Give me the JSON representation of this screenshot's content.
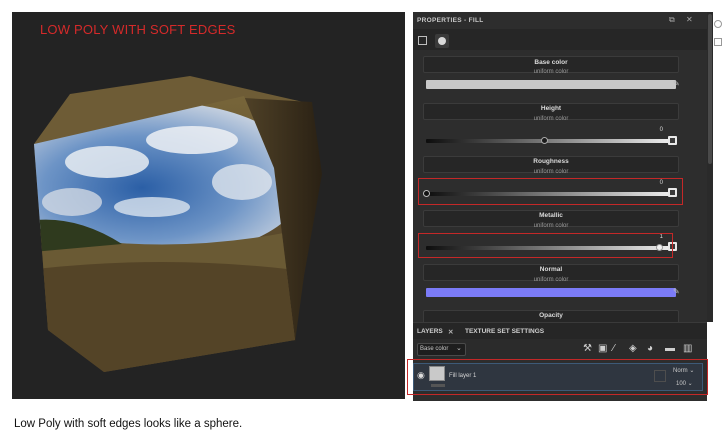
{
  "viewport": {
    "title": "LOW POLY WITH SOFT EDGES"
  },
  "properties_panel": {
    "title": "PROPERTIES - FILL",
    "window_buttons": [
      "⧉",
      "✕"
    ],
    "channels": [
      {
        "name": "Base color",
        "mode": "uniform color",
        "type": "color",
        "color": "#c8c8c8"
      },
      {
        "name": "Height",
        "mode": "uniform color",
        "type": "slider",
        "value": "0",
        "level": 0.5
      },
      {
        "name": "Roughness",
        "mode": "uniform color",
        "type": "slider",
        "value": "0",
        "level": 0.0
      },
      {
        "name": "Metallic",
        "mode": "uniform color",
        "type": "slider",
        "value": "1",
        "level": 1.0
      },
      {
        "name": "Normal",
        "mode": "uniform color",
        "type": "color",
        "color": "#7b7bf7"
      },
      {
        "name": "Opacity"
      }
    ],
    "highlight_color": "#c42828"
  },
  "layers_panel": {
    "tabs": [
      "LAYERS",
      "TEXTURE SET SETTINGS"
    ],
    "tab_close": "✕",
    "channel_dropdown": "Base color",
    "tool_icons": [
      "wrench-icon",
      "add-effect-icon",
      "paint-brush-icon",
      "fill-bucket-icon",
      "smart-material-icon",
      "folder-icon",
      "trash-icon"
    ],
    "layer": {
      "name": "Fill layer 1",
      "blend_mode": "Norm",
      "opacity": "100"
    }
  },
  "caption": "Low Poly with soft edges looks like a sphere."
}
